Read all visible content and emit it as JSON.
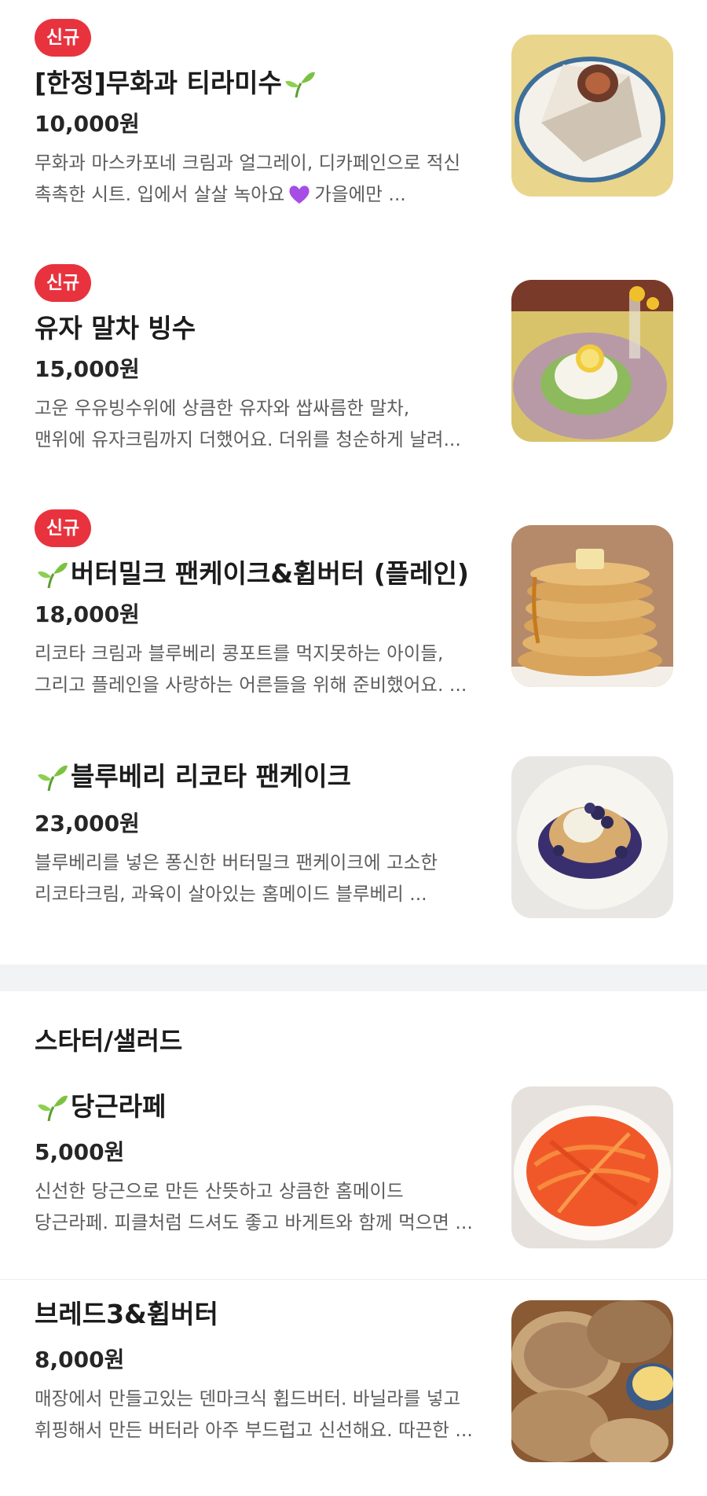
{
  "badge_new": "신규",
  "items_top": [
    {
      "name": "[한정]무화과 티라미수",
      "price": "10,000원",
      "desc_line1": "무화과 마스카포네 크림과 얼그레이, 디카페인으로 적신",
      "desc_line2a": "촉촉한 시트. 입에서 살살 녹아요",
      "desc_line2b": "가을에만 ..."
    },
    {
      "name": "유자 말차 빙수",
      "price": "15,000원",
      "desc_line1": "고운 우유빙수위에 상큼한 유자와 쌉싸름한 말차,",
      "desc_line2": "맨위에 유자크림까지 더했어요. 더위를 청순하게 날려..."
    },
    {
      "name": "버터밀크 팬케이크&휩버터 (플레인)",
      "price": "18,000원",
      "desc_line1": "리코타 크림과 블루베리 콩포트를 먹지못하는 아이들,",
      "desc_line2": "그리고 플레인을 사랑하는 어른들을 위해 준비했어요. ..."
    },
    {
      "name": "블루베리 리코타 팬케이크",
      "price": "23,000원",
      "desc_line1": "블루베리를 넣은 퐁신한 버터밀크 팬케이크에 고소한",
      "desc_line2": "리코타크림, 과육이 살아있는 홈메이드 블루베리 ..."
    }
  ],
  "section_title": "스타터/샐러드",
  "items_bottom": [
    {
      "name": "당근라페",
      "price": "5,000원",
      "desc_line1": "신선한 당근으로 만든 산뜻하고 상큼한 홈메이드",
      "desc_line2": "당근라페. 피클처럼 드셔도 좋고 바게트와 함께 먹으면 ..."
    },
    {
      "name": "브레드3&휩버터",
      "price": "8,000원",
      "desc_line1": "매장에서 만들고있는 덴마크식 휩드버터. 바닐라를 넣고",
      "desc_line2": "휘핑해서 만든 버터라 아주 부드럽고 신선해요. 따끈한 ..."
    }
  ],
  "icons": [
    "sprout-icon",
    "purple-heart-icon"
  ],
  "colors": {
    "badge": "#e8333f",
    "divider": "#f2f3f5",
    "text_main": "#1c1c1c",
    "text_desc": "#5d5d5d"
  }
}
